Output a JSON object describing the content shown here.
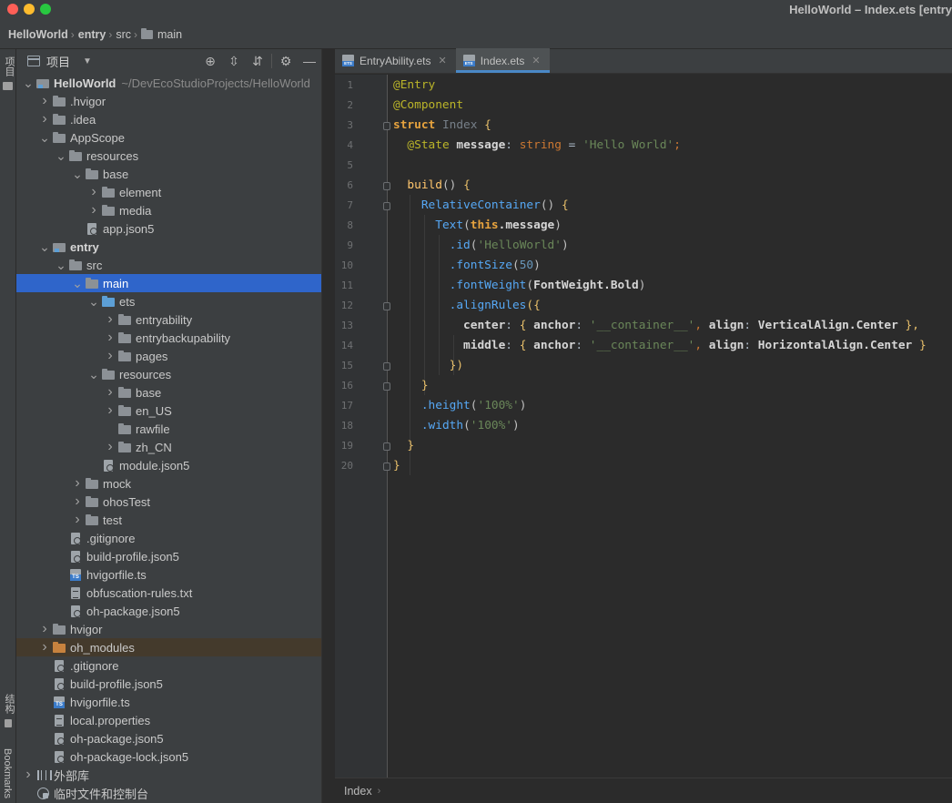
{
  "window": {
    "title": "HelloWorld – Index.ets [entry"
  },
  "breadcrumbs": [
    "HelloWorld",
    "entry",
    "src",
    "main"
  ],
  "left_strip": {
    "project_label": "项目",
    "structure_label": "结构",
    "bookmarks_label": "Bookmarks"
  },
  "project_panel": {
    "title": "项目",
    "tools": [
      "locate-icon",
      "expand-all-icon",
      "collapse-all-icon",
      "gear-icon",
      "minimize-icon"
    ],
    "root_path_hint": "~/DevEcoStudioProjects/HelloWorld",
    "tree": [
      {
        "label": "HelloWorld",
        "depth": 0,
        "state": "open",
        "icon": "module",
        "bold": true
      },
      {
        "label": ".hvigor",
        "depth": 1,
        "state": "closed",
        "icon": "folder"
      },
      {
        "label": ".idea",
        "depth": 1,
        "state": "closed",
        "icon": "folder"
      },
      {
        "label": "AppScope",
        "depth": 1,
        "state": "open",
        "icon": "folder"
      },
      {
        "label": "resources",
        "depth": 2,
        "state": "open",
        "icon": "folder"
      },
      {
        "label": "base",
        "depth": 3,
        "state": "open",
        "icon": "folder"
      },
      {
        "label": "element",
        "depth": 4,
        "state": "closed",
        "icon": "folder"
      },
      {
        "label": "media",
        "depth": 4,
        "state": "closed",
        "icon": "folder"
      },
      {
        "label": "app.json5",
        "depth": 3,
        "state": "none",
        "icon": "cfg"
      },
      {
        "label": "entry",
        "depth": 1,
        "state": "open",
        "icon": "module",
        "bold": true
      },
      {
        "label": "src",
        "depth": 2,
        "state": "open",
        "icon": "folder"
      },
      {
        "label": "main",
        "depth": 3,
        "state": "open",
        "icon": "folder",
        "selected": true
      },
      {
        "label": "ets",
        "depth": 4,
        "state": "open",
        "icon": "folder-blue"
      },
      {
        "label": "entryability",
        "depth": 5,
        "state": "closed",
        "icon": "folder"
      },
      {
        "label": "entrybackupability",
        "depth": 5,
        "state": "closed",
        "icon": "folder"
      },
      {
        "label": "pages",
        "depth": 5,
        "state": "closed",
        "icon": "folder"
      },
      {
        "label": "resources",
        "depth": 4,
        "state": "open",
        "icon": "folder"
      },
      {
        "label": "base",
        "depth": 5,
        "state": "closed",
        "icon": "folder"
      },
      {
        "label": "en_US",
        "depth": 5,
        "state": "closed",
        "icon": "folder"
      },
      {
        "label": "rawfile",
        "depth": 5,
        "state": "none",
        "icon": "folder"
      },
      {
        "label": "zh_CN",
        "depth": 5,
        "state": "closed",
        "icon": "folder"
      },
      {
        "label": "module.json5",
        "depth": 4,
        "state": "none",
        "icon": "cfg"
      },
      {
        "label": "mock",
        "depth": 3,
        "state": "closed",
        "icon": "folder"
      },
      {
        "label": "ohosTest",
        "depth": 3,
        "state": "closed",
        "icon": "folder"
      },
      {
        "label": "test",
        "depth": 3,
        "state": "closed",
        "icon": "folder"
      },
      {
        "label": ".gitignore",
        "depth": 2,
        "state": "none",
        "icon": "cfg"
      },
      {
        "label": "build-profile.json5",
        "depth": 2,
        "state": "none",
        "icon": "cfg"
      },
      {
        "label": "hvigorfile.ts",
        "depth": 2,
        "state": "none",
        "icon": "ts"
      },
      {
        "label": "obfuscation-rules.txt",
        "depth": 2,
        "state": "none",
        "icon": "file"
      },
      {
        "label": "oh-package.json5",
        "depth": 2,
        "state": "none",
        "icon": "cfg"
      },
      {
        "label": "hvigor",
        "depth": 1,
        "state": "closed",
        "icon": "folder"
      },
      {
        "label": "oh_modules",
        "depth": 1,
        "state": "closed",
        "icon": "folder-orange",
        "excluded": true
      },
      {
        "label": ".gitignore",
        "depth": 1,
        "state": "none",
        "icon": "cfg"
      },
      {
        "label": "build-profile.json5",
        "depth": 1,
        "state": "none",
        "icon": "cfg"
      },
      {
        "label": "hvigorfile.ts",
        "depth": 1,
        "state": "none",
        "icon": "ts"
      },
      {
        "label": "local.properties",
        "depth": 1,
        "state": "none",
        "icon": "file"
      },
      {
        "label": "oh-package.json5",
        "depth": 1,
        "state": "none",
        "icon": "cfg"
      },
      {
        "label": "oh-package-lock.json5",
        "depth": 1,
        "state": "none",
        "icon": "cfg"
      },
      {
        "label": "外部库",
        "depth": 0,
        "state": "closed",
        "icon": "lib"
      },
      {
        "label": "临时文件和控制台",
        "depth": 0,
        "state": "none",
        "icon": "scratch"
      }
    ]
  },
  "editor": {
    "tabs": [
      {
        "label": "EntryAbility.ets",
        "active": false
      },
      {
        "label": "Index.ets",
        "active": true
      }
    ],
    "lines": [
      [
        [
          "@Entry",
          "anno"
        ]
      ],
      [
        [
          "@Component",
          "anno"
        ]
      ],
      [
        [
          "struct ",
          "kwb"
        ],
        [
          "Index ",
          "cls"
        ],
        [
          "{",
          "brace"
        ]
      ],
      [
        [
          "  "
        ],
        [
          "@State ",
          "anno"
        ],
        [
          "message",
          "white"
        ],
        [
          ": "
        ],
        [
          "string ",
          "kw"
        ],
        [
          "= "
        ],
        [
          "'Hello World'",
          "str"
        ],
        [
          ";",
          "punc"
        ]
      ],
      [
        [
          ""
        ]
      ],
      [
        [
          "  "
        ],
        [
          "build",
          "fn"
        ],
        [
          "() ",
          "par"
        ],
        [
          "{",
          "brace"
        ]
      ],
      [
        [
          "    "
        ],
        [
          "RelativeContainer",
          "call"
        ],
        [
          "() ",
          "par"
        ],
        [
          "{",
          "brace"
        ]
      ],
      [
        [
          "      "
        ],
        [
          "Text",
          "call"
        ],
        [
          "(",
          "par"
        ],
        [
          "this",
          "kwb"
        ],
        [
          ".message",
          "white"
        ],
        [
          ")",
          "par"
        ]
      ],
      [
        [
          "        "
        ],
        [
          ".id",
          "meth"
        ],
        [
          "(",
          "par"
        ],
        [
          "'HelloWorld'",
          "str"
        ],
        [
          ")",
          "par"
        ]
      ],
      [
        [
          "        "
        ],
        [
          ".fontSize",
          "meth"
        ],
        [
          "(",
          "par"
        ],
        [
          "50",
          "num"
        ],
        [
          ")",
          "par"
        ]
      ],
      [
        [
          "        "
        ],
        [
          ".fontWeight",
          "meth"
        ],
        [
          "(",
          "par"
        ],
        [
          "FontWeight.Bold",
          "white"
        ],
        [
          ")",
          "par"
        ]
      ],
      [
        [
          "        "
        ],
        [
          ".alignRules",
          "meth"
        ],
        [
          "({",
          "brace"
        ]
      ],
      [
        [
          "          "
        ],
        [
          "center",
          "white"
        ],
        [
          ": "
        ],
        [
          "{ ",
          "brace"
        ],
        [
          "anchor",
          "white"
        ],
        [
          ": "
        ],
        [
          "'__container__'",
          "str"
        ],
        [
          ", ",
          "punc"
        ],
        [
          "align",
          "white"
        ],
        [
          ": "
        ],
        [
          "VerticalAlign.Center ",
          "white"
        ],
        [
          "},",
          "brace"
        ]
      ],
      [
        [
          "          "
        ],
        [
          "middle",
          "white"
        ],
        [
          ": "
        ],
        [
          "{ ",
          "brace"
        ],
        [
          "anchor",
          "white"
        ],
        [
          ": "
        ],
        [
          "'__container__'",
          "str"
        ],
        [
          ", ",
          "punc"
        ],
        [
          "align",
          "white"
        ],
        [
          ": "
        ],
        [
          "HorizontalAlign.Center ",
          "white"
        ],
        [
          "}",
          "brace"
        ]
      ],
      [
        [
          "        "
        ],
        [
          "})",
          "brace"
        ]
      ],
      [
        [
          "    "
        ],
        [
          "}",
          "brace"
        ]
      ],
      [
        [
          "    "
        ],
        [
          ".height",
          "meth"
        ],
        [
          "(",
          "par"
        ],
        [
          "'100%'",
          "str"
        ],
        [
          ")",
          "par"
        ]
      ],
      [
        [
          "    "
        ],
        [
          ".width",
          "meth"
        ],
        [
          "(",
          "par"
        ],
        [
          "'100%'",
          "str"
        ],
        [
          ")",
          "par"
        ]
      ],
      [
        [
          "  "
        ],
        [
          "}",
          "brace"
        ]
      ],
      [
        [
          "}",
          "brace"
        ]
      ]
    ],
    "fold_lines": [
      3,
      6,
      7,
      12,
      15,
      16,
      19,
      20
    ]
  },
  "status": {
    "crumb": "Index"
  }
}
